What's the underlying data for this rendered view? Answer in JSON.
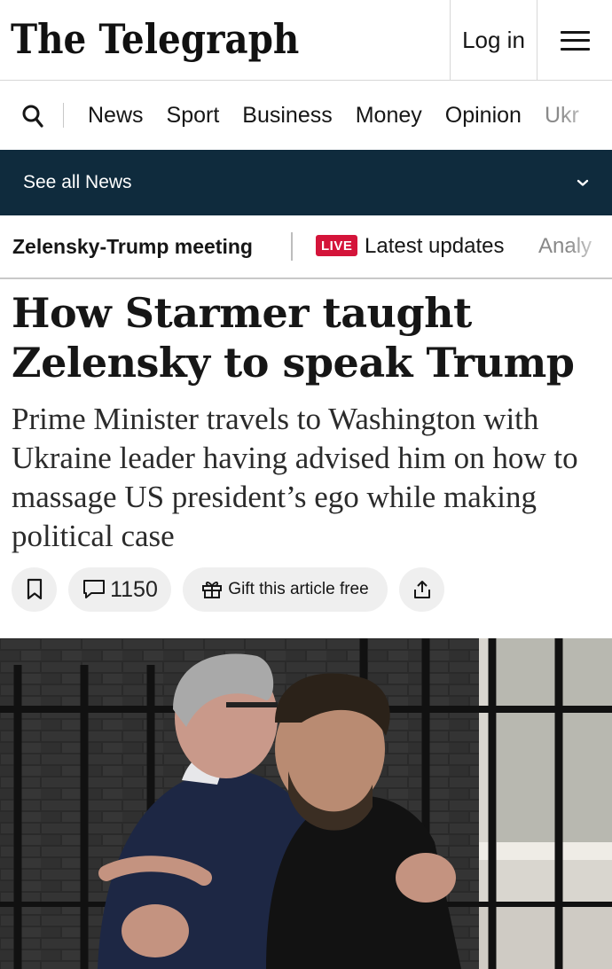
{
  "header": {
    "logo_text": "The Telegraph",
    "login_label": "Log in",
    "menu_icon": "hamburger-menu-icon"
  },
  "nav": {
    "search_icon": "search-icon",
    "items": [
      "News",
      "Sport",
      "Business",
      "Money",
      "Opinion",
      "Ukr"
    ]
  },
  "section_bar": {
    "label": "See all News",
    "icon": "chevron-down-icon"
  },
  "topic_bar": {
    "main_topic": "Zelensky-Trump meeting",
    "live_badge": "LIVE",
    "live_label": "Latest updates",
    "next_item": "Analy"
  },
  "article": {
    "headline": "How Starmer taught Zelensky to speak Trump",
    "standfirst": "Prime Minister travels to Washington with Ukraine leader having advised him on how to massage US president’s ego while making political case",
    "comment_count": "1150",
    "gift_label": "Gift this article free"
  },
  "hero_image": {
    "icon": "hero-photo"
  },
  "colors": {
    "section_bar_bg": "#0f2b3d",
    "live_red": "#d4143a",
    "pill_bg": "#efefef"
  }
}
